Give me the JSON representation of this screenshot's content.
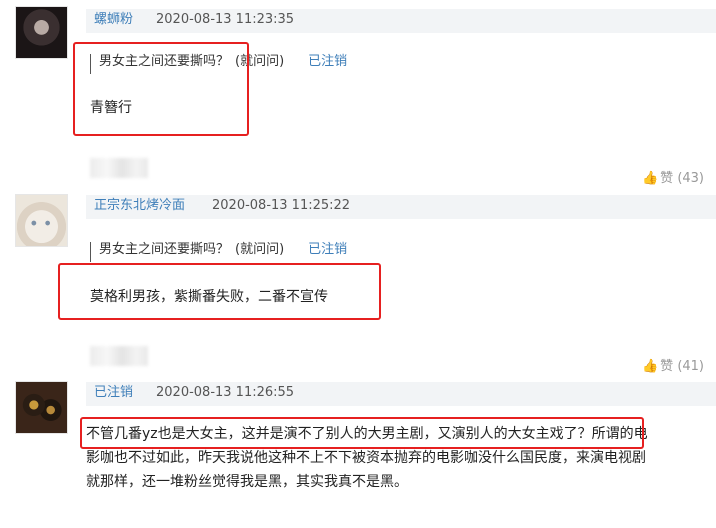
{
  "comments": [
    {
      "username": "螺蛳粉",
      "timestamp": "2020-08-13 11:23:35",
      "quote": {
        "text": "男女主之间还要撕吗？",
        "user": "(就问问)",
        "status": "已注销"
      },
      "reply": "青簪行",
      "likes": {
        "label": "赞",
        "count": "(43)"
      }
    },
    {
      "username": "正宗东北烤冷面",
      "timestamp": "2020-08-13 11:25:22",
      "quote": {
        "text": "男女主之间还要撕吗？",
        "user": "(就问问)",
        "status": "已注销"
      },
      "reply": "莫格利男孩，紫撕番失败，二番不宣传",
      "likes": {
        "label": "赞",
        "count": "(41)"
      }
    },
    {
      "username": "已注销",
      "timestamp": "2020-08-13 11:26:55",
      "reply_lines": [
        "不管几番yz也是大女主，这并是演不了别人的大男主剧，又演别人的大女主戏了？所谓的电",
        "影咖也不过如此，昨天我说他这种不上不下被资本抛弃的电影咖没什么国民度，来演电视剧",
        "就那样，还一堆粉丝觉得我是黑，其实我真不是黑。"
      ]
    }
  ],
  "colors": {
    "highlight_box": "#e62020",
    "username": "#3f7fb9"
  },
  "icons": {
    "like": "thumbs-up-icon"
  }
}
